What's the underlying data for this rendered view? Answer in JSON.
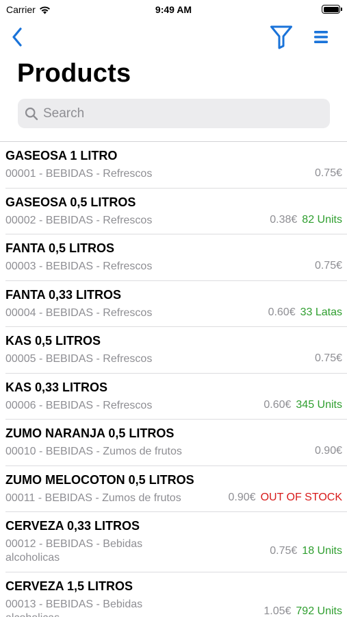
{
  "status_bar": {
    "carrier": "Carrier",
    "time": "9:49 AM"
  },
  "navbar": {
    "back_icon": "chevron-left-icon",
    "filter_icon": "filter-icon",
    "menu_icon": "list-menu-icon",
    "accent_color": "#1a73d9"
  },
  "page_title": "Products",
  "search": {
    "placeholder": "Search",
    "value": ""
  },
  "products": [
    {
      "name": "GASEOSA 1 LITRO",
      "detail_line1": "00001 - BEBIDAS - Refrescos",
      "detail_line2": "",
      "price": "0.75€",
      "stock": "",
      "stock_status": "none"
    },
    {
      "name": "GASEOSA 0,5 LITROS",
      "detail_line1": "00002 - BEBIDAS - Refrescos",
      "detail_line2": "",
      "price": "0.38€",
      "stock": "82 Units",
      "stock_status": "in"
    },
    {
      "name": "FANTA 0,5 LITROS",
      "detail_line1": "00003 - BEBIDAS - Refrescos",
      "detail_line2": "",
      "price": "0.75€",
      "stock": "",
      "stock_status": "none"
    },
    {
      "name": "FANTA 0,33 LITROS",
      "detail_line1": "00004 - BEBIDAS - Refrescos",
      "detail_line2": "",
      "price": "0.60€",
      "stock": "33 Latas",
      "stock_status": "in"
    },
    {
      "name": "KAS 0,5 LITROS",
      "detail_line1": "00005 - BEBIDAS - Refrescos",
      "detail_line2": "",
      "price": "0.75€",
      "stock": "",
      "stock_status": "none"
    },
    {
      "name": "KAS 0,33 LITROS",
      "detail_line1": "00006 - BEBIDAS - Refrescos",
      "detail_line2": "",
      "price": "0.60€",
      "stock": "345 Units",
      "stock_status": "in"
    },
    {
      "name": "ZUMO NARANJA 0,5 LITROS",
      "detail_line1": "00010 - BEBIDAS - Zumos de frutos",
      "detail_line2": "",
      "price": "0.90€",
      "stock": "",
      "stock_status": "none"
    },
    {
      "name": "ZUMO MELOCOTON 0,5 LITROS",
      "detail_line1": "00011 - BEBIDAS - Zumos de frutos",
      "detail_line2": "",
      "price": "0.90€",
      "stock": "OUT OF STOCK",
      "stock_status": "out"
    },
    {
      "name": "CERVEZA 0,33 LITROS",
      "detail_line1": "00012 - BEBIDAS - Bebidas",
      "detail_line2": "alcoholicas",
      "price": "0.75€",
      "stock": "18 Units",
      "stock_status": "in"
    },
    {
      "name": "CERVEZA 1,5 LITROS",
      "detail_line1": "00013 - BEBIDAS - Bebidas",
      "detail_line2": "alcoholicas",
      "price": "1.05€",
      "stock": "792 Units",
      "stock_status": "in"
    }
  ],
  "colors": {
    "in_stock": "#2e9e2e",
    "out_of_stock": "#d81a1a",
    "secondary_text": "#8e8e93"
  }
}
